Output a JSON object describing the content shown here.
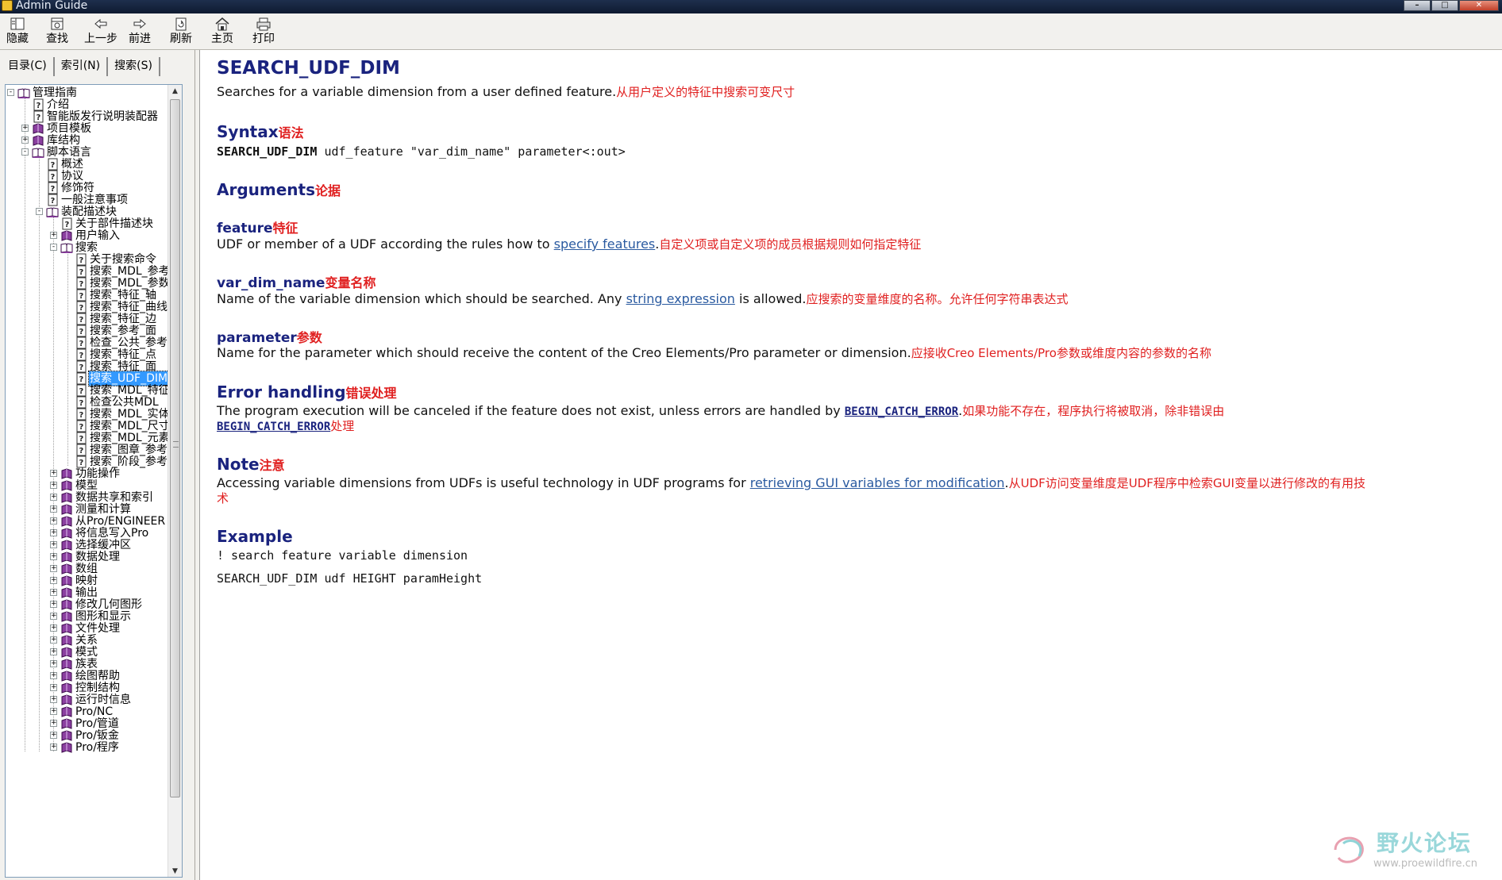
{
  "window": {
    "title": "Admin Guide",
    "controls": [
      "–",
      "□",
      "✕"
    ]
  },
  "toolbar": [
    {
      "id": "hide",
      "label": "隐藏",
      "icon": "hide-icon"
    },
    {
      "id": "find",
      "label": "查找",
      "icon": "find-icon"
    },
    {
      "id": "back",
      "label": "上一步",
      "icon": "back-arrow-icon"
    },
    {
      "id": "forward",
      "label": "前进",
      "icon": "forward-arrow-icon"
    },
    {
      "id": "refresh",
      "label": "刷新",
      "icon": "refresh-icon"
    },
    {
      "id": "home",
      "label": "主页",
      "icon": "home-icon"
    },
    {
      "id": "print",
      "label": "打印",
      "icon": "print-icon"
    }
  ],
  "tabs": [
    {
      "label": "目录(C)",
      "active": true
    },
    {
      "label": "索引(N)",
      "active": false
    },
    {
      "label": "搜索(S)",
      "active": false
    }
  ],
  "tree": [
    {
      "label": "管理指南",
      "level": 0,
      "type": "book-open",
      "expander": "-"
    },
    {
      "label": "介绍",
      "level": 1,
      "type": "page"
    },
    {
      "label": "智能版发行说明装配器",
      "level": 1,
      "type": "page"
    },
    {
      "label": "项目模板",
      "level": 1,
      "type": "book",
      "expander": "+"
    },
    {
      "label": "库结构",
      "level": 1,
      "type": "book",
      "expander": "+"
    },
    {
      "label": "脚本语言",
      "level": 1,
      "type": "book-open",
      "expander": "-"
    },
    {
      "label": "概述",
      "level": 2,
      "type": "page"
    },
    {
      "label": "协议",
      "level": 2,
      "type": "page"
    },
    {
      "label": "修饰符",
      "level": 2,
      "type": "page"
    },
    {
      "label": "一般注意事项",
      "level": 2,
      "type": "page"
    },
    {
      "label": "装配描述块",
      "level": 2,
      "type": "book-open",
      "expander": "-"
    },
    {
      "label": "关于部件描述块",
      "level": 3,
      "type": "page"
    },
    {
      "label": "用户输入",
      "level": 3,
      "type": "book",
      "expander": "+"
    },
    {
      "label": "搜索",
      "level": 3,
      "type": "book-open",
      "expander": "-"
    },
    {
      "label": "关于搜索命令",
      "level": 4,
      "type": "page"
    },
    {
      "label": "搜索_MDL_参考",
      "level": 4,
      "type": "page"
    },
    {
      "label": "搜索_MDL_参数",
      "level": 4,
      "type": "page"
    },
    {
      "label": "搜索_特征_轴",
      "level": 4,
      "type": "page"
    },
    {
      "label": "搜索_特征_曲线",
      "level": 4,
      "type": "page"
    },
    {
      "label": "搜索_特征_边",
      "level": 4,
      "type": "page"
    },
    {
      "label": "搜索_参考_面",
      "level": 4,
      "type": "page"
    },
    {
      "label": "检查_公共_参考",
      "level": 4,
      "type": "page"
    },
    {
      "label": "搜索_特征_点",
      "level": 4,
      "type": "page"
    },
    {
      "label": "搜索_特征_面",
      "level": 4,
      "type": "page"
    },
    {
      "label": "搜索_UDF_DIM",
      "level": 4,
      "type": "page",
      "selected": true
    },
    {
      "label": "搜索_MDL_特征",
      "level": 4,
      "type": "page"
    },
    {
      "label": "检查公共MDL",
      "level": 4,
      "type": "page"
    },
    {
      "label": "搜索_MDL_实体",
      "level": 4,
      "type": "page"
    },
    {
      "label": "搜索_MDL_尺寸",
      "level": 4,
      "type": "page"
    },
    {
      "label": "搜索_MDL_元素",
      "level": 4,
      "type": "page"
    },
    {
      "label": "搜索_图章_参考",
      "level": 4,
      "type": "page"
    },
    {
      "label": "搜索_阶段_参考",
      "level": 4,
      "type": "page"
    },
    {
      "label": "功能操作",
      "level": 3,
      "type": "book",
      "expander": "+"
    },
    {
      "label": "模型",
      "level": 3,
      "type": "book",
      "expander": "+"
    },
    {
      "label": "数据共享和索引",
      "level": 3,
      "type": "book",
      "expander": "+"
    },
    {
      "label": "测量和计算",
      "level": 3,
      "type": "book",
      "expander": "+"
    },
    {
      "label": "从Pro/ENGINEER",
      "level": 3,
      "type": "book",
      "expander": "+"
    },
    {
      "label": "将信息写入Pro",
      "level": 3,
      "type": "book",
      "expander": "+"
    },
    {
      "label": "选择缓冲区",
      "level": 3,
      "type": "book",
      "expander": "+"
    },
    {
      "label": "数据处理",
      "level": 3,
      "type": "book",
      "expander": "+"
    },
    {
      "label": "数组",
      "level": 3,
      "type": "book",
      "expander": "+"
    },
    {
      "label": "映射",
      "level": 3,
      "type": "book",
      "expander": "+"
    },
    {
      "label": "输出",
      "level": 3,
      "type": "book",
      "expander": "+"
    },
    {
      "label": "修改几何图形",
      "level": 3,
      "type": "book",
      "expander": "+"
    },
    {
      "label": "图形和显示",
      "level": 3,
      "type": "book",
      "expander": "+"
    },
    {
      "label": "文件处理",
      "level": 3,
      "type": "book",
      "expander": "+"
    },
    {
      "label": "关系",
      "level": 3,
      "type": "book",
      "expander": "+"
    },
    {
      "label": "模式",
      "level": 3,
      "type": "book",
      "expander": "+"
    },
    {
      "label": "族表",
      "level": 3,
      "type": "book",
      "expander": "+"
    },
    {
      "label": "绘图帮助",
      "level": 3,
      "type": "book",
      "expander": "+"
    },
    {
      "label": "控制结构",
      "level": 3,
      "type": "book",
      "expander": "+"
    },
    {
      "label": "运行时信息",
      "level": 3,
      "type": "book",
      "expander": "+"
    },
    {
      "label": "Pro/NC",
      "level": 3,
      "type": "book",
      "expander": "+"
    },
    {
      "label": "Pro/管道",
      "level": 3,
      "type": "book",
      "expander": "+"
    },
    {
      "label": "Pro/钣金",
      "level": 3,
      "type": "book",
      "expander": "+"
    },
    {
      "label": "Pro/程序",
      "level": 3,
      "type": "book",
      "expander": "+"
    }
  ],
  "doc": {
    "title": "SEARCH_UDF_DIM",
    "intro_en": "Searches for a variable dimension from a user defined feature.",
    "intro_cn": "从用户定义的特征中搜索可变尺寸",
    "syntax_heading": "Syntax",
    "syntax_heading_cn": "语法",
    "syntax_keyword": "SEARCH_UDF_DIM",
    "syntax_rest": " udf_feature \"var_dim_name\" parameter<:out>",
    "arguments_heading": "Arguments",
    "arguments_heading_cn": "论据",
    "feature_heading": "feature",
    "feature_heading_cn": "特征",
    "feature_text_pre": "UDF or member of a UDF according the rules how to ",
    "feature_link": "specify features",
    "feature_text_post": ".",
    "feature_cn": "自定义项或自定义项的成员根据规则如何指定特征",
    "vardim_heading": "var_dim_name",
    "vardim_heading_cn": "变量名称",
    "vardim_text_pre": "Name of the variable dimension which should be searched. Any ",
    "vardim_link": "string expression",
    "vardim_text_post": " is allowed.",
    "vardim_cn": "应搜索的变量维度的名称。允许任何字符串表达式",
    "param_heading": "parameter",
    "param_heading_cn": "参数",
    "param_text": "Name for the parameter which should receive the content of the Creo Elements/Pro parameter or dimension.",
    "param_cn": "应接收Creo Elements/Pro参数或维度内容的参数的名称",
    "error_heading": "Error handling",
    "error_heading_cn": "错误处理",
    "error_text_pre": "The program execution will be canceled if the feature does not exist, unless errors are handled by ",
    "error_link1": "BEGIN_CATCH_ERROR",
    "error_text_mid": ".",
    "error_cn1": "如果功能不存在，程序执行将被取消，除非错误由",
    "error_link2": "BEGIN_CATCH_ERROR",
    "error_cn2": "处理",
    "note_heading": "Note",
    "note_heading_cn": "注意",
    "note_text_pre": "Accessing variable dimensions from UDFs is useful technology in UDF programs for ",
    "note_link": "retrieving GUI variables for modification",
    "note_text_post": ".",
    "note_cn1": "从UDF访问变量维度是UDF程序中检索GUI变量以进行修改的有用技",
    "note_cn2": "术",
    "example_heading": "Example",
    "example_line1": "! search feature variable dimension",
    "example_line2": "SEARCH_UDF_DIM udf HEIGHT paramHeight"
  },
  "watermark": {
    "text": "野火论坛",
    "url": "www.proewildfire.cn"
  },
  "colors": {
    "heading": "#1a237e",
    "chinese_text": "#e02020",
    "link": "#2a5aa0",
    "selection": "#3399ff"
  }
}
